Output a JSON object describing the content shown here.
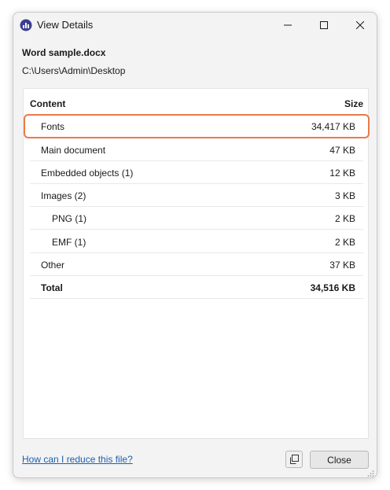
{
  "window": {
    "title": "View Details"
  },
  "file": {
    "name": "Word sample.docx",
    "path": "C:\\Users\\Admin\\Desktop"
  },
  "table": {
    "header": {
      "content": "Content",
      "size": "Size"
    },
    "rows": [
      {
        "label": "Fonts",
        "value": "34,417 KB",
        "highlighted": true
      },
      {
        "label": "Main document",
        "value": "47 KB"
      },
      {
        "label": "Embedded objects (1)",
        "value": "12 KB"
      },
      {
        "label": "Images (2)",
        "value": "3 KB"
      },
      {
        "label": "PNG (1)",
        "value": "2 KB",
        "indent": true
      },
      {
        "label": "EMF (1)",
        "value": "2 KB",
        "indent": true
      },
      {
        "label": "Other",
        "value": "37 KB"
      }
    ],
    "total": {
      "label": "Total",
      "value": "34,516 KB"
    }
  },
  "footer": {
    "help_link": "How can I reduce this file?",
    "close_label": "Close"
  },
  "colors": {
    "highlight": "#e87a4a",
    "link": "#1a5fb4"
  },
  "icons": {
    "app": "bar-chart-app-icon",
    "copy": "copy-icon",
    "minimize": "minimize-icon",
    "maximize": "maximize-icon",
    "close": "close-icon"
  }
}
